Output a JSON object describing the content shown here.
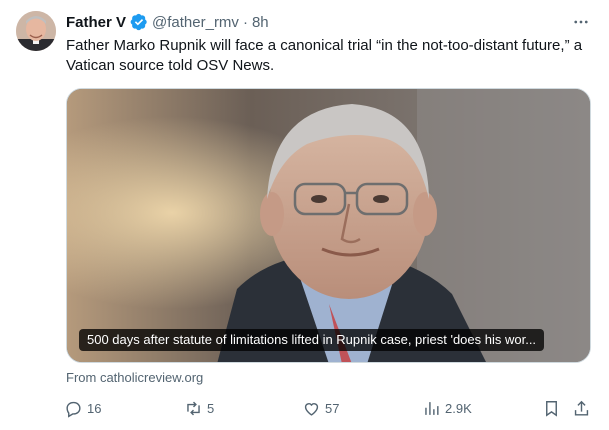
{
  "tweet": {
    "author_name": "Father V",
    "handle": "@father_rmv",
    "separator": "·",
    "time": "8h",
    "text": "Father Marko Rupnik will face a canonical trial “in the not-too-distant future,” a Vatican source told OSV News.",
    "verified": true,
    "accent_color": "#1d9bf0"
  },
  "card": {
    "caption": "500 days after statute of limitations lifted in Rupnik case, priest 'does his wor...",
    "source": "From catholicreview.org"
  },
  "actions": {
    "replies": "16",
    "reposts": "5",
    "likes": "57",
    "views": "2.9K"
  },
  "icons": {
    "more": "more-dots-icon",
    "reply": "reply-icon",
    "repost": "repost-icon",
    "like": "heart-icon",
    "views": "views-icon",
    "bookmark": "bookmark-icon",
    "share": "share-icon"
  }
}
